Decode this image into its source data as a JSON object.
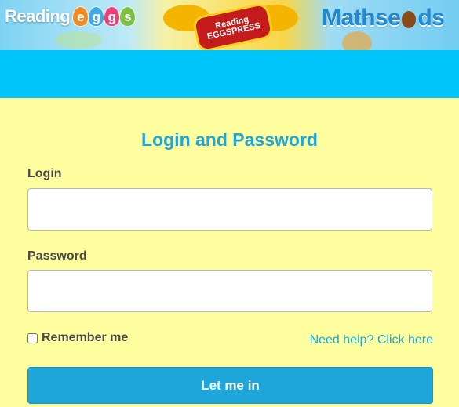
{
  "header": {
    "logos": [
      {
        "name": "Reading",
        "letters": [
          "e",
          "g",
          "g",
          "s"
        ],
        "egg_colors": [
          "#f58a25",
          "#3fa9e0",
          "#e8427d",
          "#7cc242"
        ]
      },
      {
        "name": "Reading Eggspress",
        "line1": "Reading",
        "line2": "EGGSPRESS"
      },
      {
        "name": "Mathseeds",
        "part1": "Mathse",
        "part2": "ds"
      }
    ]
  },
  "form": {
    "title": "Login and Password",
    "login_label": "Login",
    "login_value": "",
    "password_label": "Password",
    "password_value": "",
    "remember_label": "Remember me",
    "remember_checked": false,
    "help_link": "Need help? Click here",
    "submit_label": "Let me in"
  },
  "colors": {
    "accent": "#1ea6db",
    "panel_bg": "#ffff9f",
    "sky": "#00c6fb"
  }
}
